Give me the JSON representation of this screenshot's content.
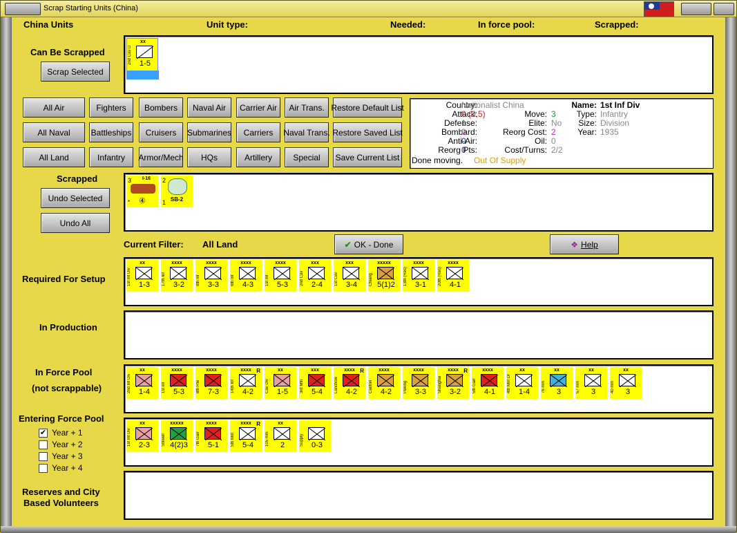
{
  "window": {
    "title": "Scrap Starting Units (China)"
  },
  "header": {
    "col1": "China Units",
    "col2": "Unit type:",
    "col3": "Needed:",
    "col4": "In force pool:",
    "col5": "Scrapped:"
  },
  "can_scrap": {
    "label": "Can Be Scrapped",
    "button": "Scrap Selected",
    "counters": [
      {
        "top": "xx",
        "side": "2nd Cav Div",
        "bottom": "1-5"
      }
    ]
  },
  "filters": {
    "air": [
      "All Air",
      "Fighters",
      "Bombers",
      "Naval Air",
      "Carrier Air",
      "Air Trans.",
      "Restore Default List"
    ],
    "naval": [
      "All Naval",
      "Battleships",
      "Cruisers",
      "Submarines",
      "Carriers",
      "Naval Trans.",
      "Restore Saved List"
    ],
    "land": [
      "All Land",
      "Infantry",
      "Armor/Mech",
      "HQs",
      "Artillery",
      "Special",
      "Save Current List"
    ]
  },
  "info": {
    "country_label": "Country:",
    "country": "Nationalist China",
    "attack_label": "Attack:",
    "attack": "0 (0,5)",
    "defense_label": "Defense:",
    "defense": "1",
    "bombard_label": "Bombard:",
    "bombard": "0",
    "antiair_label": "Anti-Air:",
    "antiair": "0",
    "reorgpts_label": "Reorg Pts:",
    "reorgpts": "0",
    "move_label": "Move:",
    "move": "3",
    "elite_label": "Elite:",
    "elite": "No",
    "reorgcost_label": "Reorg Cost:",
    "reorgcost": "2",
    "oil_label": "Oil:",
    "oil": "0",
    "cost_label": "Cost/Turns:",
    "cost": "2/2",
    "name_label": "Name:",
    "name": "1st Inf Div",
    "type_label": "Type:",
    "type": "Infantry",
    "size_label": "Size:",
    "size": "Division",
    "year_label": "Year:",
    "year": "1935",
    "done": "Done moving.",
    "supply": "Out Of Supply"
  },
  "scrapped": {
    "label": "Scrapped",
    "undo_selected": "Undo Selected",
    "undo_all": "Undo All",
    "counters": [
      {
        "top": "I-16",
        "left_num": "3",
        "bot": "④"
      },
      {
        "top": "2",
        "left_num": "1",
        "bot": "SB-2"
      }
    ]
  },
  "filter_bar": {
    "label": "Current Filter:",
    "value": "All Land",
    "ok": "OK - Done",
    "help": "Help"
  },
  "required": {
    "label": "Required For Setup",
    "counters": [
      {
        "top": "xx",
        "side": "1st Inf Div",
        "bottom": "1-3",
        "color": "#ffffff"
      },
      {
        "top": "xxxx",
        "side": "17th Inf",
        "bottom": "3-2",
        "color": "#ffffff"
      },
      {
        "top": "xxxx",
        "side": "8th Inf",
        "bottom": "3-3",
        "color": "#ffffff"
      },
      {
        "top": "xxxx",
        "side": "6th Inf",
        "bottom": "4-3",
        "color": "#ffffff"
      },
      {
        "top": "xxxx",
        "side": "1st Inf",
        "bottom": "5-3",
        "color": "#ffffff"
      },
      {
        "top": "xxx",
        "side": "2nd Cav",
        "bottom": "2-4",
        "color": "#ffffff"
      },
      {
        "top": "xxx",
        "side": "1st Cav",
        "bottom": "3-4",
        "color": "#ffffff"
      },
      {
        "top": "xxxxx",
        "side": "Chiang",
        "bottom": "5(1)2",
        "color": "#d8a040"
      },
      {
        "top": "xxxx",
        "side": "13th (Res)",
        "bottom": "3-1",
        "color": "#ffffff"
      },
      {
        "top": "xxxx",
        "side": "20th (Res)",
        "bottom": "4-1",
        "color": "#ffffff"
      }
    ]
  },
  "production": {
    "label": "In Production"
  },
  "force_pool": {
    "label1": "In Force Pool",
    "label2": "(not scrappable)",
    "counters": [
      {
        "top": "xx",
        "side": "2nd Inf Div",
        "bottom": "1-4",
        "color": "#e8a0a0",
        "mark": ""
      },
      {
        "top": "xxxx",
        "side": "1st Inf",
        "bottom": "5-3",
        "color": "#e02020",
        "mark": ""
      },
      {
        "top": "xxxx",
        "side": "8th Rte",
        "bottom": "7-3",
        "color": "#e02020",
        "mark": ""
      },
      {
        "top": "xxxx",
        "side": "14th Inf",
        "bottom": "4-2",
        "color": "#ffffff",
        "mark": "R"
      },
      {
        "top": "xx",
        "side": "Cav Div",
        "bottom": "1-5",
        "color": "#e8a0a0",
        "mark": ""
      },
      {
        "top": "xxx",
        "side": "3rd Mtn",
        "bottom": "5-4",
        "color": "#e02020",
        "mark": ""
      },
      {
        "top": "xxxx",
        "side": "Lanchow",
        "bottom": "4-2",
        "color": "#e02020",
        "mark": "R"
      },
      {
        "top": "xxxx",
        "side": "Canton",
        "bottom": "4-2",
        "color": "#d8a040",
        "mark": ""
      },
      {
        "top": "xxxx",
        "side": "Peking",
        "bottom": "3-3",
        "color": "#d8a040",
        "mark": ""
      },
      {
        "top": "xxxx",
        "side": "Shanghai",
        "bottom": "3-2",
        "color": "#d8a040",
        "mark": "R"
      },
      {
        "top": "xxxx",
        "side": "5th Garr",
        "bottom": "4-1",
        "color": "#e02020",
        "mark": ""
      },
      {
        "top": "xx",
        "side": "4th Mot Div",
        "bottom": "1-4",
        "color": "#ffffff",
        "mark": ""
      },
      {
        "top": "xx",
        "side": "76 mm",
        "bottom": "3",
        "color": "#40b0e0",
        "mark": ""
      },
      {
        "top": "xx",
        "side": "57 mm",
        "bottom": "3",
        "color": "#ffffff",
        "mark": ""
      },
      {
        "top": "xx",
        "side": "40 mm",
        "bottom": "3",
        "color": "#ffffff",
        "mark": ""
      }
    ]
  },
  "entering": {
    "label": "Entering Force Pool",
    "years": [
      {
        "label": "Year + 1",
        "checked": "✔"
      },
      {
        "label": "Year + 2",
        "checked": ""
      },
      {
        "label": "Year + 3",
        "checked": ""
      },
      {
        "label": "Year + 4",
        "checked": ""
      }
    ],
    "counters": [
      {
        "top": "xx",
        "side": "1st Inf Div",
        "bottom": "2-3",
        "color": "#e8a0a0",
        "mark": ""
      },
      {
        "top": "xxxxx",
        "side": "Stilwell",
        "bottom": "4(2)3",
        "color": "#20a040",
        "mark": ""
      },
      {
        "top": "xxxx",
        "side": "7th Garr",
        "bottom": "5-1",
        "color": "#e02020",
        "mark": ""
      },
      {
        "top": "xxxx",
        "side": "5th Mot",
        "bottom": "5-4",
        "color": "#ffffff",
        "mark": "R"
      },
      {
        "top": "xx",
        "side": "105 mm",
        "bottom": "2",
        "color": "#ffffff",
        "mark": ""
      },
      {
        "top": "",
        "side": "Supply",
        "bottom": "0-3",
        "color": "#ffffff",
        "mark": ""
      }
    ]
  },
  "reserves": {
    "label1": "Reserves and City",
    "label2": "Based Volunteers"
  }
}
